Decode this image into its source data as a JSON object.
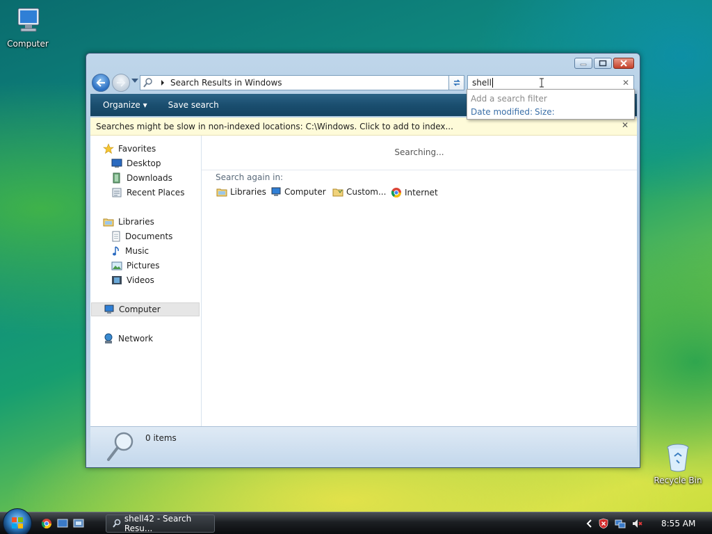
{
  "desktop": {
    "icons": [
      {
        "label": "Computer"
      },
      {
        "label": "Recycle Bin"
      }
    ]
  },
  "window": {
    "address": "Search Results in Windows",
    "search_value": "shell",
    "toolbar": {
      "organize": "Organize",
      "save_search": "Save search"
    },
    "infobar": "Searches might be slow in non-indexed locations: C:\\Windows. Click to add to index...",
    "search_dropdown": {
      "hint": "Add a search filter",
      "options": [
        "Date modified:",
        "Size:"
      ]
    },
    "nav": {
      "favorites": {
        "label": "Favorites",
        "items": [
          "Desktop",
          "Downloads",
          "Recent Places"
        ]
      },
      "libraries": {
        "label": "Libraries",
        "items": [
          "Documents",
          "Music",
          "Pictures",
          "Videos"
        ]
      },
      "computer": "Computer",
      "network": "Network"
    },
    "content": {
      "status": "Searching...",
      "search_again_label": "Search again in:",
      "locations": [
        "Libraries",
        "Computer",
        "Custom...",
        "Internet"
      ]
    },
    "statusbar": {
      "items_count": "0 items"
    }
  },
  "taskbar": {
    "window_button": "shell42 - Search Resu...",
    "clock": "8:55 AM"
  },
  "colors": {
    "accent": "#1a4e6f",
    "link": "#3a6fa8",
    "infobar": "#fefbd9"
  }
}
